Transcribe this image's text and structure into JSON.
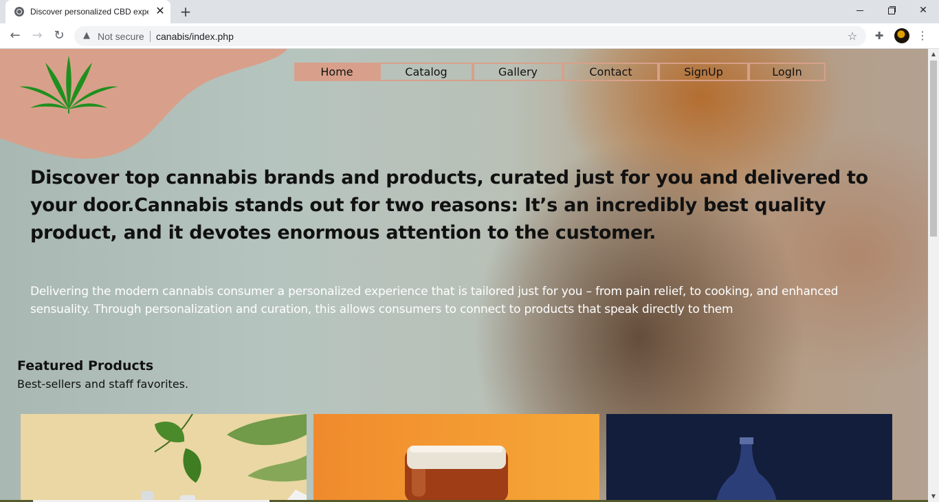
{
  "browser": {
    "tab_title": "Discover personalized CBD experiences",
    "tab_close": "✕",
    "new_tab": "+",
    "security_label": "Not secure",
    "url": "canabis/index.php",
    "icons": {
      "favicon": "globe-icon",
      "back": "arrow-left-icon",
      "forward": "arrow-right-icon",
      "reload": "reload-icon",
      "warning": "warning-icon",
      "bookmark": "star-icon",
      "extensions": "puzzle-icon",
      "menu": "kebab-menu-icon"
    }
  },
  "nav": {
    "items": [
      {
        "label": "Home",
        "active": true
      },
      {
        "label": "Catalog",
        "active": false
      },
      {
        "label": "Gallery",
        "active": false
      },
      {
        "label": "Contact",
        "active": false
      },
      {
        "label": "SignUp",
        "active": false
      },
      {
        "label": "LogIn",
        "active": false
      }
    ]
  },
  "hero": {
    "headline": "Discover top cannabis brands and products, curated just for you and delivered to your door.Cannabis stands out for two reasons: It’s an incredibly best quality product, and it devotes enormous attention to the customer.",
    "intro": "Delivering the modern cannabis consumer a personalized experience that is tailored just for you – from pain relief, to cooking, and enhanced sensuality. Through personalization and curation, this allows consumers to connect to products that speak directly to them"
  },
  "featured": {
    "title": "Featured Products",
    "subtitle": "Best-sellers and staff favorites."
  },
  "colors": {
    "accent": "#d8a08a",
    "leaf": "#1f8f1f",
    "card1": "#ead7a3",
    "card2": "#f08a2c",
    "card3": "#121e3c"
  }
}
